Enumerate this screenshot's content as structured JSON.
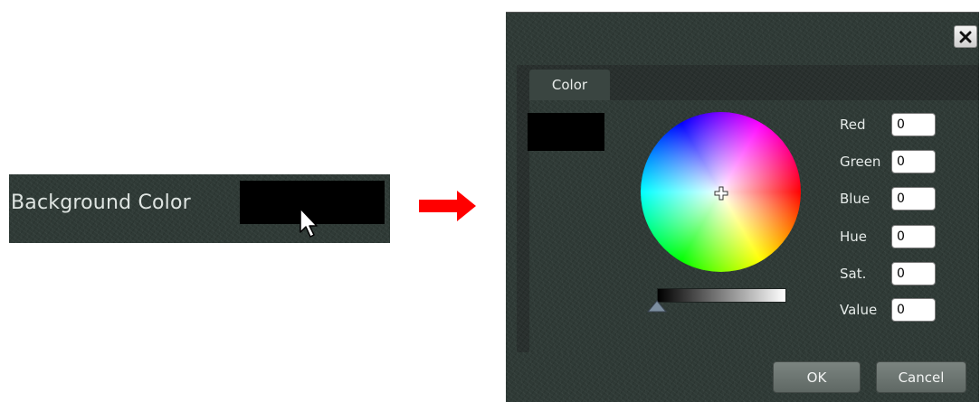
{
  "background_setting": {
    "label": "Background Color",
    "swatch_color": "#000000"
  },
  "transition_arrow": {
    "color": "#ff0000",
    "icon": "right-arrow-icon"
  },
  "color_dialog": {
    "close_icon": "close-icon",
    "tabs": [
      {
        "label": "Color"
      }
    ],
    "preview_color": "#000000",
    "wheel_icon": "color-wheel",
    "fields": [
      {
        "label": "Red",
        "value": "0"
      },
      {
        "label": "Green",
        "value": "0"
      },
      {
        "label": "Blue",
        "value": "0"
      },
      {
        "label": "Hue",
        "value": "0"
      },
      {
        "label": "Sat.",
        "value": "0"
      },
      {
        "label": "Value",
        "value": "0"
      }
    ],
    "value_slider_level": 0,
    "buttons": {
      "ok": "OK",
      "cancel": "Cancel"
    }
  }
}
